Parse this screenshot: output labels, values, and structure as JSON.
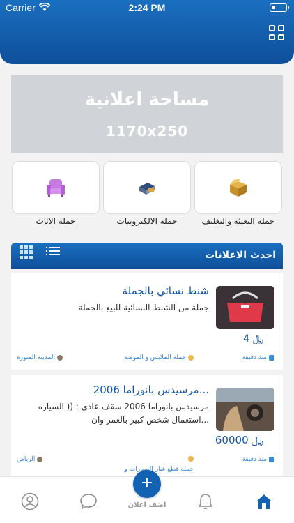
{
  "status_bar": {
    "carrier": "Carrier",
    "time": "2:24 PM"
  },
  "header": {
    "menu_icon": "grid-menu-icon"
  },
  "ad_banner": {
    "title": "مساحة اعلانية",
    "size": "1170x250"
  },
  "categories": [
    {
      "label": "جملة الاثاث",
      "icon": "armchair-icon"
    },
    {
      "label": "جملة الالكترونيات",
      "icon": "electronics-icon"
    },
    {
      "label": "جملة التعبئة والتغليف",
      "icon": "box-icon"
    }
  ],
  "latest_ads": {
    "title": "احدث الاعلانات",
    "items": [
      {
        "title": "شنط نسائي بالجملة",
        "description": "جملة من الشنط النسائية للبيع بالجملة",
        "price": "4 ﷼",
        "time": "منذ دقيقة",
        "category": "جملة الملابس و الموضة",
        "city": "المدينة المنورة"
      },
      {
        "title": "مرسيدس بانوراما 2006...",
        "description": "مرسيدس بانوراما 2006 سقف عادي : (( السياره استعمال شخص كبير بالعمر وان...",
        "price": "60000 ﷼",
        "time": "منذ دقيقة",
        "category": "جملة قطع غيار السيارات و الدراجات النارية",
        "city": "الرياض"
      }
    ]
  },
  "tabbar": {
    "add_label": "اضف اعلان",
    "accent_color": "#1262b3"
  }
}
